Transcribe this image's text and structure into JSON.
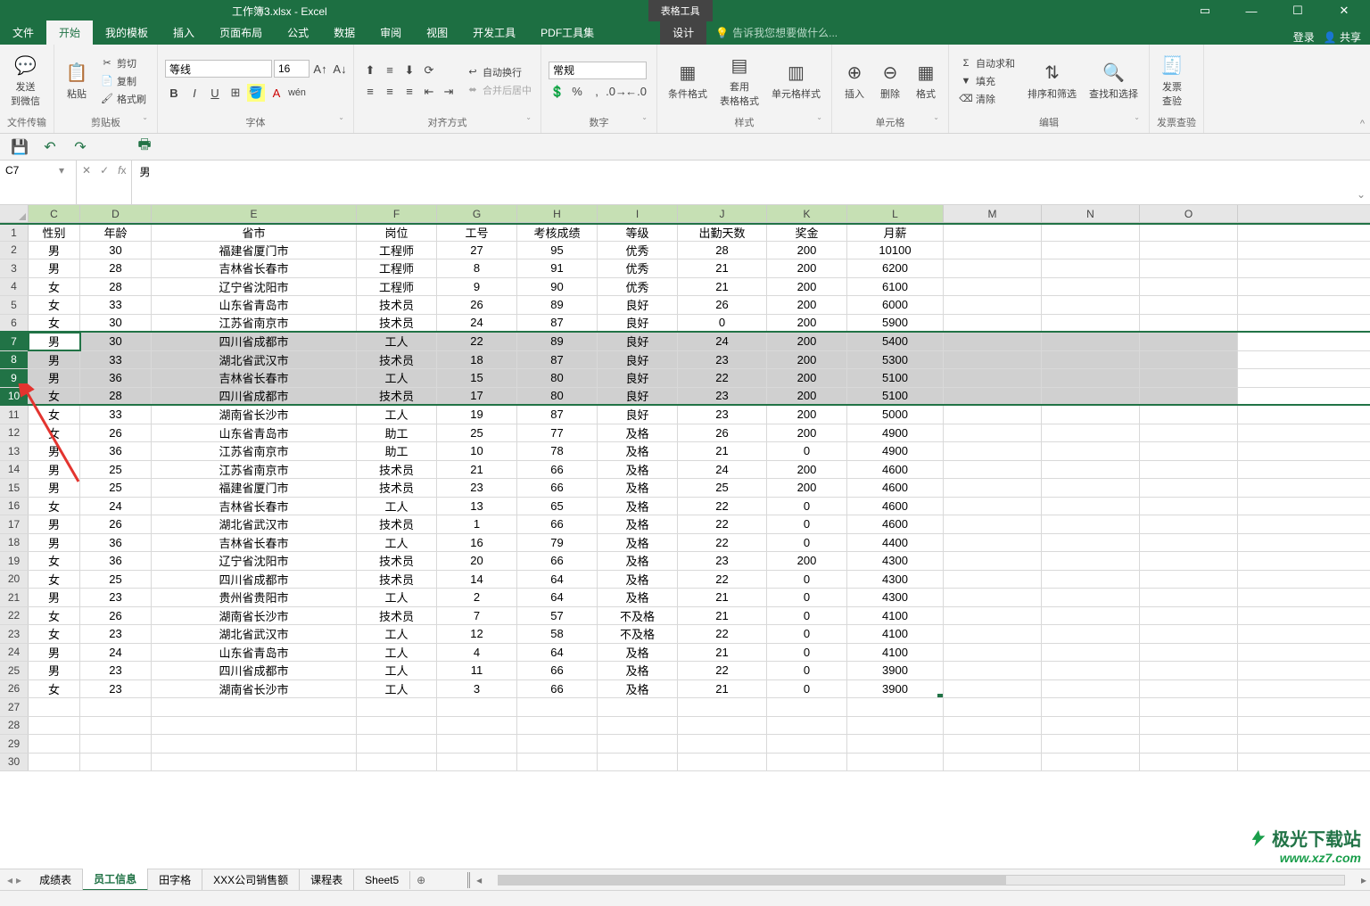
{
  "titlebar": {
    "title": "工作簿3.xlsx - Excel",
    "tabletools": "表格工具",
    "login": "登录",
    "share": "共享"
  },
  "menutabs": {
    "file": "文件",
    "home": "开始",
    "mytpl": "我的模板",
    "insert": "插入",
    "pagelayout": "页面布局",
    "formulas": "公式",
    "data": "数据",
    "review": "审阅",
    "view": "视图",
    "dev": "开发工具",
    "pdf": "PDF工具集",
    "design": "设计",
    "tellme": "告诉我您想要做什么..."
  },
  "ribbon": {
    "send_wechat": "发送\n到微信",
    "filetransfer": "文件传输",
    "paste": "粘贴",
    "cut": "剪切",
    "copy": "复制",
    "formatpainter": "格式刷",
    "clipboard": "剪贴板",
    "fontname": "等线",
    "fontsize": "16",
    "fontgroup": "字体",
    "wrap": "自动换行",
    "merge": "合并后居中",
    "aligngroup": "对齐方式",
    "numfmt": "常规",
    "numgroup": "数字",
    "condfmt": "条件格式",
    "tablefmt": "套用\n表格格式",
    "cellfmt": "单元格样式",
    "stylegroup": "样式",
    "insert": "插入",
    "delete": "删除",
    "format": "格式",
    "cellgroup": "单元格",
    "autosum": "自动求和",
    "fill": "填充",
    "clear": "清除",
    "sortfilter": "排序和筛选",
    "findselect": "查找和选择",
    "editgroup": "编辑",
    "invoice": "发票\n查验",
    "invoicegroup": "发票查验"
  },
  "namebox": "C7",
  "formula": "男",
  "columns": {
    "C": "C",
    "D": "D",
    "E": "E",
    "F": "F",
    "G": "G",
    "H": "H",
    "I": "I",
    "J": "J",
    "K": "K",
    "L": "L",
    "M": "M",
    "N": "N",
    "O": "O"
  },
  "headers": {
    "C": "性别",
    "D": "年龄",
    "E": "省市",
    "F": "岗位",
    "G": "工号",
    "H": "考核成绩",
    "I": "等级",
    "J": "出勤天数",
    "K": "奖金",
    "L": "月薪"
  },
  "rows": [
    {
      "n": 2,
      "C": "男",
      "D": "30",
      "E": "福建省厦门市",
      "F": "工程师",
      "G": "27",
      "H": "95",
      "I": "优秀",
      "J": "28",
      "K": "200",
      "L": "10100"
    },
    {
      "n": 3,
      "C": "男",
      "D": "28",
      "E": "吉林省长春市",
      "F": "工程师",
      "G": "8",
      "H": "91",
      "I": "优秀",
      "J": "21",
      "K": "200",
      "L": "6200"
    },
    {
      "n": 4,
      "C": "女",
      "D": "28",
      "E": "辽宁省沈阳市",
      "F": "工程师",
      "G": "9",
      "H": "90",
      "I": "优秀",
      "J": "21",
      "K": "200",
      "L": "6100"
    },
    {
      "n": 5,
      "C": "女",
      "D": "33",
      "E": "山东省青岛市",
      "F": "技术员",
      "G": "26",
      "H": "89",
      "I": "良好",
      "J": "26",
      "K": "200",
      "L": "6000"
    },
    {
      "n": 6,
      "C": "女",
      "D": "30",
      "E": "江苏省南京市",
      "F": "技术员",
      "G": "24",
      "H": "87",
      "I": "良好",
      "J": "0",
      "K": "200",
      "L": "5900"
    },
    {
      "n": 7,
      "C": "男",
      "D": "30",
      "E": "四川省成都市",
      "F": "工人",
      "G": "22",
      "H": "89",
      "I": "良好",
      "J": "24",
      "K": "200",
      "L": "5400",
      "sel": true,
      "active": true
    },
    {
      "n": 8,
      "C": "男",
      "D": "33",
      "E": "湖北省武汉市",
      "F": "技术员",
      "G": "18",
      "H": "87",
      "I": "良好",
      "J": "23",
      "K": "200",
      "L": "5300",
      "sel": true
    },
    {
      "n": 9,
      "C": "男",
      "D": "36",
      "E": "吉林省长春市",
      "F": "工人",
      "G": "15",
      "H": "80",
      "I": "良好",
      "J": "22",
      "K": "200",
      "L": "5100",
      "sel": true
    },
    {
      "n": 10,
      "C": "女",
      "D": "28",
      "E": "四川省成都市",
      "F": "技术员",
      "G": "17",
      "H": "80",
      "I": "良好",
      "J": "23",
      "K": "200",
      "L": "5100",
      "sel": true
    },
    {
      "n": 11,
      "C": "女",
      "D": "33",
      "E": "湖南省长沙市",
      "F": "工人",
      "G": "19",
      "H": "87",
      "I": "良好",
      "J": "23",
      "K": "200",
      "L": "5000"
    },
    {
      "n": 12,
      "C": "女",
      "D": "26",
      "E": "山东省青岛市",
      "F": "助工",
      "G": "25",
      "H": "77",
      "I": "及格",
      "J": "26",
      "K": "200",
      "L": "4900"
    },
    {
      "n": 13,
      "C": "男",
      "D": "36",
      "E": "江苏省南京市",
      "F": "助工",
      "G": "10",
      "H": "78",
      "I": "及格",
      "J": "21",
      "K": "0",
      "L": "4900"
    },
    {
      "n": 14,
      "C": "男",
      "D": "25",
      "E": "江苏省南京市",
      "F": "技术员",
      "G": "21",
      "H": "66",
      "I": "及格",
      "J": "24",
      "K": "200",
      "L": "4600"
    },
    {
      "n": 15,
      "C": "男",
      "D": "25",
      "E": "福建省厦门市",
      "F": "技术员",
      "G": "23",
      "H": "66",
      "I": "及格",
      "J": "25",
      "K": "200",
      "L": "4600"
    },
    {
      "n": 16,
      "C": "女",
      "D": "24",
      "E": "吉林省长春市",
      "F": "工人",
      "G": "13",
      "H": "65",
      "I": "及格",
      "J": "22",
      "K": "0",
      "L": "4600"
    },
    {
      "n": 17,
      "C": "男",
      "D": "26",
      "E": "湖北省武汉市",
      "F": "技术员",
      "G": "1",
      "H": "66",
      "I": "及格",
      "J": "22",
      "K": "0",
      "L": "4600"
    },
    {
      "n": 18,
      "C": "男",
      "D": "36",
      "E": "吉林省长春市",
      "F": "工人",
      "G": "16",
      "H": "79",
      "I": "及格",
      "J": "22",
      "K": "0",
      "L": "4400"
    },
    {
      "n": 19,
      "C": "女",
      "D": "36",
      "E": "辽宁省沈阳市",
      "F": "技术员",
      "G": "20",
      "H": "66",
      "I": "及格",
      "J": "23",
      "K": "200",
      "L": "4300"
    },
    {
      "n": 20,
      "C": "女",
      "D": "25",
      "E": "四川省成都市",
      "F": "技术员",
      "G": "14",
      "H": "64",
      "I": "及格",
      "J": "22",
      "K": "0",
      "L": "4300"
    },
    {
      "n": 21,
      "C": "男",
      "D": "23",
      "E": "贵州省贵阳市",
      "F": "工人",
      "G": "2",
      "H": "64",
      "I": "及格",
      "J": "21",
      "K": "0",
      "L": "4300"
    },
    {
      "n": 22,
      "C": "女",
      "D": "26",
      "E": "湖南省长沙市",
      "F": "技术员",
      "G": "7",
      "H": "57",
      "I": "不及格",
      "J": "21",
      "K": "0",
      "L": "4100"
    },
    {
      "n": 23,
      "C": "女",
      "D": "23",
      "E": "湖北省武汉市",
      "F": "工人",
      "G": "12",
      "H": "58",
      "I": "不及格",
      "J": "22",
      "K": "0",
      "L": "4100"
    },
    {
      "n": 24,
      "C": "男",
      "D": "24",
      "E": "山东省青岛市",
      "F": "工人",
      "G": "4",
      "H": "64",
      "I": "及格",
      "J": "21",
      "K": "0",
      "L": "4100"
    },
    {
      "n": 25,
      "C": "男",
      "D": "23",
      "E": "四川省成都市",
      "F": "工人",
      "G": "11",
      "H": "66",
      "I": "及格",
      "J": "22",
      "K": "0",
      "L": "3900"
    },
    {
      "n": 26,
      "C": "女",
      "D": "23",
      "E": "湖南省长沙市",
      "F": "工人",
      "G": "3",
      "H": "66",
      "I": "及格",
      "J": "21",
      "K": "0",
      "L": "3900"
    }
  ],
  "emptyrows": [
    27,
    28,
    29,
    30
  ],
  "sheets": {
    "s1": "成绩表",
    "s2": "员工信息",
    "s3": "田字格",
    "s4": "XXX公司销售额",
    "s5": "课程表",
    "s6": "Sheet5"
  },
  "watermark": {
    "brand": "极光下载站",
    "url": "www.xz7.com"
  }
}
